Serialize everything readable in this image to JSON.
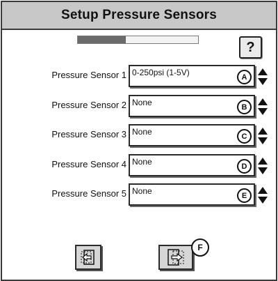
{
  "title": "Setup Pressure Sensors",
  "progress": {
    "fraction": 0.4
  },
  "help_label": "?",
  "sensors": [
    {
      "label": "Pressure Sensor 1",
      "value": "0-250psi (1-5V)",
      "letter": "A"
    },
    {
      "label": "Pressure Sensor 2",
      "value": "None",
      "letter": "B"
    },
    {
      "label": "Pressure Sensor 3",
      "value": "None",
      "letter": "C"
    },
    {
      "label": "Pressure Sensor 4",
      "value": "None",
      "letter": "D"
    },
    {
      "label": "Pressure Sensor 5",
      "value": "None",
      "letter": "E"
    }
  ],
  "nav": {
    "next_letter": "F"
  },
  "icons": {
    "back": "back-page-icon",
    "next": "next-page-icon",
    "spinner": "up-down-arrows-icon"
  }
}
